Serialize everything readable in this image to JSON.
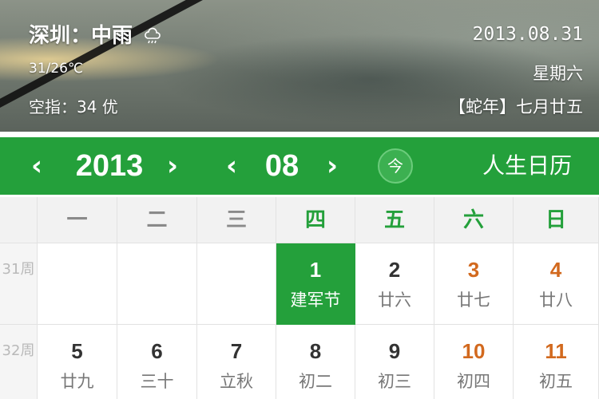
{
  "weather": {
    "city_condition": "深圳：中雨",
    "temperature": "31/26℃",
    "air_quality": "空指：34 优",
    "icon": "cloud-rain-icon",
    "date": "2013.08.31",
    "weekday": "星期六",
    "lunar": "【蛇年】七月廿五"
  },
  "nav": {
    "prev_label": "‹",
    "next_label": "›",
    "year": "2013",
    "month": "08",
    "today_label": "今",
    "title": "人生日历"
  },
  "calendar": {
    "weekdays": [
      "一",
      "二",
      "三",
      "四",
      "五",
      "六",
      "日"
    ],
    "weeks": [
      {
        "label": "31周",
        "days": [
          {
            "num": "",
            "sub": ""
          },
          {
            "num": "",
            "sub": ""
          },
          {
            "num": "",
            "sub": ""
          },
          {
            "num": "1",
            "sub": "建军节",
            "selected": true
          },
          {
            "num": "2",
            "sub": "廿六"
          },
          {
            "num": "3",
            "sub": "廿七",
            "weekend": true
          },
          {
            "num": "4",
            "sub": "廿八",
            "weekend": true
          }
        ]
      },
      {
        "label": "32周",
        "days": [
          {
            "num": "5",
            "sub": "廿九"
          },
          {
            "num": "6",
            "sub": "三十"
          },
          {
            "num": "7",
            "sub": "立秋"
          },
          {
            "num": "8",
            "sub": "初二"
          },
          {
            "num": "9",
            "sub": "初三"
          },
          {
            "num": "10",
            "sub": "初四",
            "weekend": true
          },
          {
            "num": "11",
            "sub": "初五",
            "weekend": true
          }
        ]
      }
    ]
  },
  "colors": {
    "accent": "#24a03b",
    "weekend": "#d2691e",
    "header_bg": "#f2f2f2"
  }
}
